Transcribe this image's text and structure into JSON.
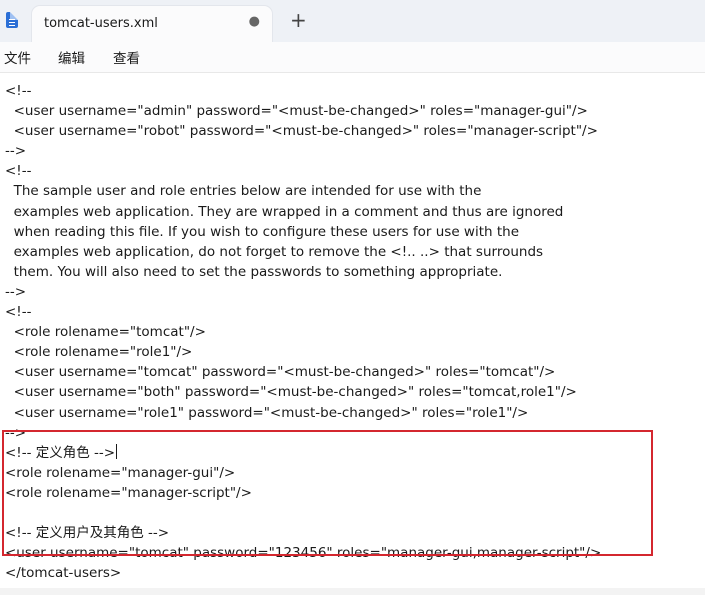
{
  "window": {
    "tab_title": "tomcat-users.xml",
    "tab_modified_marker": "●",
    "new_tab_label": "+"
  },
  "menu": [
    "文件",
    "编辑",
    "查看"
  ],
  "editor": {
    "lines": [
      "<!--",
      "  <user username=\"admin\" password=\"<must-be-changed>\" roles=\"manager-gui\"/>",
      "  <user username=\"robot\" password=\"<must-be-changed>\" roles=\"manager-script\"/>",
      "-->",
      "<!--",
      "  The sample user and role entries below are intended for use with the",
      "  examples web application. They are wrapped in a comment and thus are ignored",
      "  when reading this file. If you wish to configure these users for use with the",
      "  examples web application, do not forget to remove the <!.. ..> that surrounds",
      "  them. You will also need to set the passwords to something appropriate.",
      "-->",
      "<!--",
      "  <role rolename=\"tomcat\"/>",
      "  <role rolename=\"role1\"/>",
      "  <user username=\"tomcat\" password=\"<must-be-changed>\" roles=\"tomcat\"/>",
      "  <user username=\"both\" password=\"<must-be-changed>\" roles=\"tomcat,role1\"/>",
      "  <user username=\"role1\" password=\"<must-be-changed>\" roles=\"role1\"/>",
      "-->",
      "<!-- 定义角色 -->",
      "<role rolename=\"manager-gui\"/>",
      "<role rolename=\"manager-script\"/>",
      "",
      "<!-- 定义用户及其角色 -->",
      "<user username=\"tomcat\" password=\"123456\" roles=\"manager-gui,manager-script\"/>",
      "</tomcat-users>"
    ]
  },
  "colors": {
    "highlight_border": "#d4272f",
    "titlebar_bg": "#eef1f6",
    "app_icon": "#2b6fd6"
  }
}
